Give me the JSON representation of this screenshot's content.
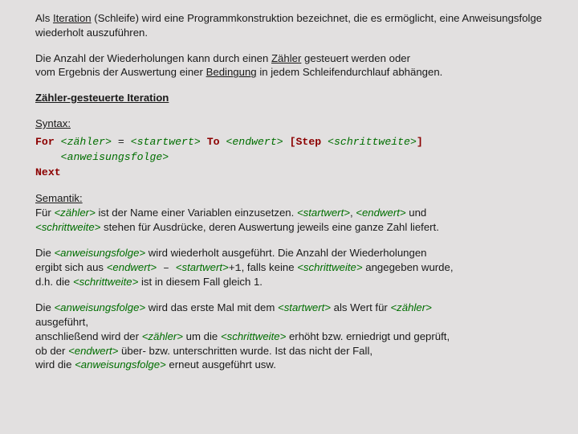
{
  "intro": {
    "t1a": "Als ",
    "t1b": "Iteration",
    "t1c": " (Schleife) wird eine Programmkonstruktion bezeichnet, die es ermöglicht, eine Anweisungsfolge wiederholt auszuführen."
  },
  "para2": {
    "a": "Die Anzahl der Wiederholungen kann durch einen ",
    "zaehler": "Zähler",
    "b": " gesteuert werden oder",
    "c": "vom Ergebnis der Auswertung einer ",
    "bedingung": "Bedingung",
    "d": " in jedem Schleifendurchlauf abhängen."
  },
  "heading": "Zähler-gesteuerte Iteration",
  "syntax_label": "Syntax:",
  "code": {
    "for": "For",
    "zaehler": "<zähler>",
    "eq": " = ",
    "startwert": "<startwert>",
    "to": " To ",
    "endwert": "<endwert>",
    "lbr": " [",
    "step": "Step",
    "sp": " ",
    "schrittweite": "<schrittweite>",
    "rbr": "]",
    "anw": "<anweisungsfolge>",
    "next": "Next"
  },
  "semantik_label": "Semantik:",
  "sem1": {
    "a": "Für ",
    "zaehler": "<zähler>",
    "b": " ist der Name einer Variablen einzusetzen.  ",
    "startwert": "<startwert>",
    "c": ", ",
    "endwert": "<endwert>",
    "d": " und",
    "schrittweite": "<schrittweite>",
    "e": " stehen für Ausdrücke, deren Auswertung jeweils eine ganze Zahl liefert."
  },
  "sem2": {
    "a": "Die ",
    "anw": "<anweisungsfolge>",
    "b": " wird wiederholt ausgeführt. Die Anzahl der Wiederholungen",
    "c": "ergibt sich aus ",
    "endwert": "<endwert>",
    "minus": " – ",
    "startwert": "<startwert>",
    "plus1": "+1",
    "d": ", falls keine ",
    "schrittweite": "<schrittweite>",
    "e": " angegeben wurde,",
    "f": "d.h. die ",
    "schrittweite2": "<schrittweite>",
    "g": " ist in diesem Fall gleich 1."
  },
  "sem3": {
    "a": "Die ",
    "anw": "<anweisungsfolge>",
    "b": " wird das erste Mal mit dem ",
    "startwert": "<startwert>",
    "c": " als Wert für ",
    "zaehler": "<zähler>",
    "d": "ausgeführt,",
    "e": "anschließend wird der ",
    "zaehler2": "<zähler>",
    "f": " um die ",
    "schrittweite": "<schrittweite>",
    "g": " erhöht bzw. erniedrigt und geprüft,",
    "h": "ob der ",
    "endwert": "<endwert>",
    "i": " über- bzw. unterschritten wurde. Ist das nicht der Fall,",
    "j": "wird die ",
    "anw2": "<anweisungsfolge>",
    "k": " erneut ausgeführt  usw."
  }
}
